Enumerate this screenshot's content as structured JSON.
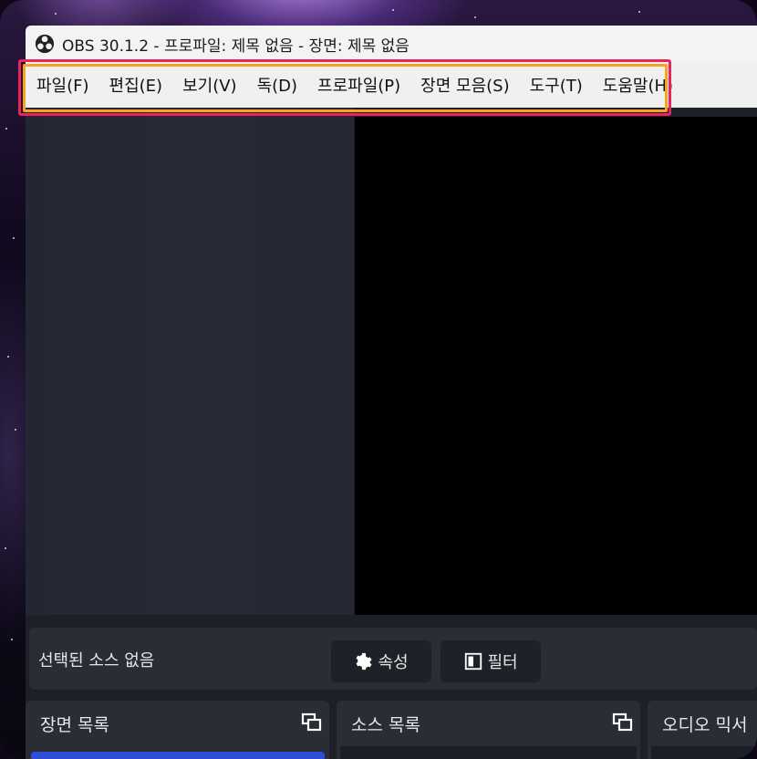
{
  "window": {
    "title": "OBS 30.1.2 - 프로파일: 제목 없음 - 장면: 제목 없음"
  },
  "menu": [
    {
      "label": "파일(F)"
    },
    {
      "label": "편집(E)"
    },
    {
      "label": "보기(V)"
    },
    {
      "label": "독(D)"
    },
    {
      "label": "프로파일(P)"
    },
    {
      "label": "장면 모음(S)"
    },
    {
      "label": "도구(T)"
    },
    {
      "label": "도움말(H)"
    }
  ],
  "source_toolbar": {
    "status": "선택된 소스 없음",
    "properties_label": "속성",
    "filters_label": "필터"
  },
  "docks": {
    "scenes": "장면 목록",
    "sources": "소스 목록",
    "audio": "오디오 믹서"
  },
  "colors": {
    "highlight_outer": "#e8245a",
    "highlight_inner": "#f5a320",
    "selected_scene": "#2e4fd6"
  }
}
